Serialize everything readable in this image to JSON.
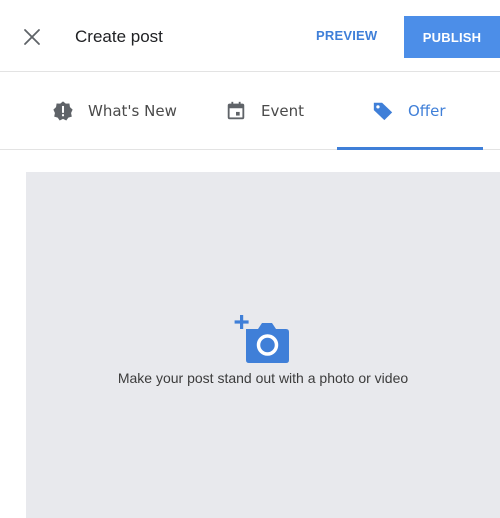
{
  "header": {
    "title": "Create post",
    "preview_label": "PREVIEW",
    "publish_label": "PUBLISH",
    "close_icon": "close-icon"
  },
  "tabs": [
    {
      "label": "What's New",
      "icon": "alert-badge-icon",
      "selected": false
    },
    {
      "label": "Event",
      "icon": "calendar-icon",
      "selected": false
    },
    {
      "label": "Offer",
      "icon": "tag-icon",
      "selected": true
    }
  ],
  "media": {
    "caption": "Make your post stand out with a photo or video",
    "icon": "add-photo-icon"
  },
  "colors": {
    "accent": "#3f7fd8",
    "publish_bg": "#4c8ee8",
    "media_bg": "#e8e9ed",
    "divider": "#e3e3e3"
  }
}
